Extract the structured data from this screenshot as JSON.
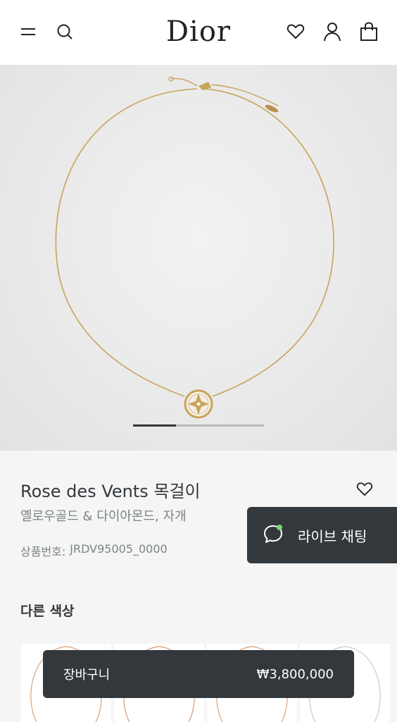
{
  "header": {
    "logo": "Dior",
    "icons": [
      "menu-icon",
      "search-icon",
      "heart-icon",
      "user-icon",
      "bag-icon"
    ]
  },
  "gallery": {
    "image_alt": "Rose des Vents necklace",
    "progress_fraction": 0.33
  },
  "product": {
    "title": "Rose des Vents 목걸이",
    "subtitle": "옐로우골드 & 다이아몬드, 자개",
    "sku_label": "상품번호:",
    "sku_value": "JRDV95005_0000"
  },
  "colors_section": {
    "heading": "다른 색상",
    "swatch_chain_colors": [
      "#d9a07a",
      "#d39a78",
      "#d9a07a",
      "#c9c9c9"
    ]
  },
  "live_chat": {
    "label": "라이브 채팅",
    "indicator_color": "#7bd66b"
  },
  "cart": {
    "label": "장바구니",
    "price": "₩3,800,000"
  },
  "colors": {
    "dark": "#33383c",
    "gold": "#c8a35a",
    "muted_text": "#7b8487"
  }
}
